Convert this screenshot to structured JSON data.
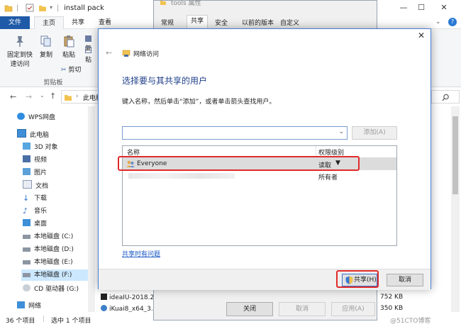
{
  "explorer": {
    "title": "install pack",
    "tabs": [
      "文件",
      "主页",
      "共享",
      "查看"
    ],
    "ribbon": {
      "pin_label_1": "固定到快",
      "pin_label_2": "速访问",
      "copy": "复制",
      "paste": "粘贴",
      "copy_path_partial": "复",
      "shortcut_partial": "粘",
      "cut": "剪切",
      "clipboard": "剪贴板"
    },
    "breadcrumb_partial": "此电脑",
    "nav": {
      "items": [
        "WPS网盘",
        "此电脑",
        "3D 对象",
        "视频",
        "图片",
        "文档",
        "下载",
        "音乐",
        "桌面",
        "本地磁盘 (C:)",
        "本地磁盘 (D:)",
        "本地磁盘 (E:)",
        "本地磁盘 (F:)",
        "CD 驱动器 (G:)",
        "网络"
      ]
    },
    "files": [
      {
        "name": "ideaIU-2018.2",
        "size": "752 KB"
      },
      {
        "name": "iKuai8_x64_3.2",
        "size": "350 KB"
      }
    ],
    "status_count": "36 个项目",
    "status_selected": "选中 1 个项目"
  },
  "properties": {
    "title": "tools 属性",
    "tabs": [
      "常规",
      "共享",
      "安全",
      "以前的版本",
      "自定义"
    ],
    "buttons": {
      "close": "关闭",
      "cancel": "取消",
      "apply": "应用(A)"
    }
  },
  "share_dialog": {
    "nav_title": "网络访问",
    "heading": "选择要与其共享的用户",
    "instruction": "键入名称，然后单击“添加”，或者单击箭头查找用户。",
    "name_input_value": "",
    "add_button": "添加(A)",
    "col_name": "名称",
    "col_permission": "权限级别",
    "rows": [
      {
        "name": "Everyone",
        "permission": "读取"
      },
      {
        "name": "",
        "permission": "所有者"
      }
    ],
    "help_link": "共享时有问题",
    "share_button": "共享(H)",
    "cancel_button": "取消"
  },
  "watermark": "@51CTO博客",
  "colors": {
    "accent": "#1e5aa8",
    "highlight_box": "#e02b2b",
    "ribbon_file_tab": "#1e5aa8"
  }
}
